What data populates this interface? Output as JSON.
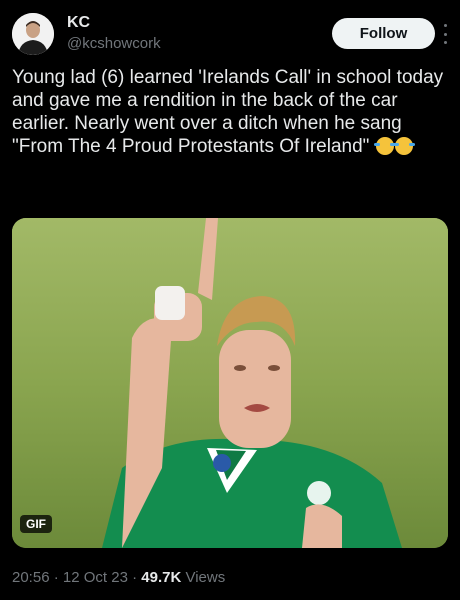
{
  "author": {
    "name": "KC",
    "handle": "@kcshowcork",
    "follow_label": "Follow"
  },
  "tweet": {
    "text": "Young lad (6) learned 'Irelands Call' in school today and gave me a rendition in the back of the car earlier. Nearly went over a ditch when he sang \"From The 4 Proud Protestants Of Ireland\"",
    "emojis": [
      "face-with-tears-of-joy",
      "face-with-tears-of-joy"
    ]
  },
  "media": {
    "badge": "GIF",
    "description_icon": "rugby-player-thumbs-up"
  },
  "meta": {
    "time": "20:56",
    "sep1": " · ",
    "date": "12 Oct 23",
    "sep2": " · ",
    "views_count": "49.7K",
    "views_label": " Views"
  },
  "colors": {
    "background": "#000000",
    "text": "#e7e9ea",
    "secondary": "#71767b",
    "follow_bg": "#eff3f4"
  }
}
